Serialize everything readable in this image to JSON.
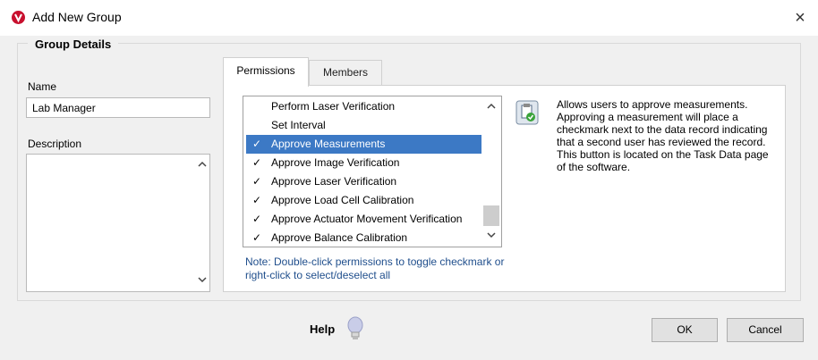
{
  "window": {
    "title": "Add New Group",
    "close_symbol": "×"
  },
  "group": {
    "title": "Group Details"
  },
  "name": {
    "label": "Name",
    "value": "Lab Manager"
  },
  "description": {
    "label": "Description",
    "value": ""
  },
  "tabs": [
    {
      "label": "Permissions",
      "active": true
    },
    {
      "label": "Members",
      "active": false
    }
  ],
  "permissions": {
    "items": [
      {
        "label": "Perform Laser Verification",
        "checked": false,
        "selected": false
      },
      {
        "label": "Set Interval",
        "checked": false,
        "selected": false
      },
      {
        "label": "Approve Measurements",
        "checked": true,
        "selected": true
      },
      {
        "label": "Approve Image Verification",
        "checked": true,
        "selected": false
      },
      {
        "label": "Approve Laser Verification",
        "checked": true,
        "selected": false
      },
      {
        "label": "Approve Load Cell Calibration",
        "checked": true,
        "selected": false
      },
      {
        "label": "Approve Actuator Movement Verification",
        "checked": true,
        "selected": false
      },
      {
        "label": "Approve Balance Calibration",
        "checked": true,
        "selected": false
      }
    ],
    "check_symbol": "✓",
    "description": "Allows users to approve measurements. Approving a measurement will place a checkmark next to the data record indicating that a second user has reviewed the record. This button is located on the Task Data page of the software.",
    "icon": "clipboard-approve-icon",
    "selected_color": "#3c79c5"
  },
  "note": "Note: Double-click permissions to toggle checkmark or right-click to select/deselect all",
  "help": {
    "label": "Help",
    "icon": "lightbulb-icon"
  },
  "buttons": {
    "ok": "OK",
    "cancel": "Cancel"
  }
}
